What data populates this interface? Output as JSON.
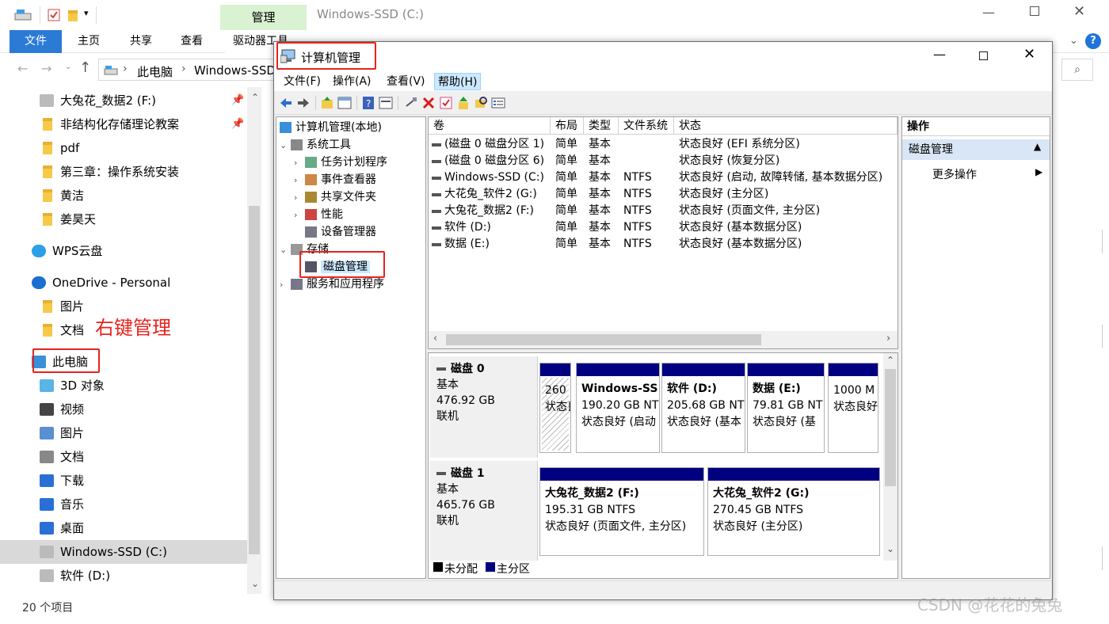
{
  "explorer": {
    "title": "Windows-SSD (C:)",
    "ribbon_context": "管理",
    "tabs": [
      "文件",
      "主页",
      "共享",
      "查看",
      "驱动器工具"
    ],
    "breadcrumb": [
      "此电脑",
      "Windows-SSD"
    ],
    "nav": [
      {
        "label": "大兔花_数据2 (F:)",
        "icon": "drive-icon",
        "pinned": true
      },
      {
        "label": "非结构化存储理论教案",
        "icon": "folder-icon",
        "pinned": true
      },
      {
        "label": "pdf",
        "icon": "folder-icon"
      },
      {
        "label": "第三章：操作系统安装",
        "icon": "folder-icon"
      },
      {
        "label": "黄洁",
        "icon": "folder-icon"
      },
      {
        "label": "姜昊天",
        "icon": "folder-icon"
      },
      {
        "label": "WPS云盘",
        "icon": "cloud-icon"
      },
      {
        "label": "OneDrive - Personal",
        "icon": "onedrive-icon"
      },
      {
        "label": "图片",
        "icon": "folder-icon"
      },
      {
        "label": "文档",
        "icon": "folder-icon"
      },
      {
        "label": "此电脑",
        "icon": "computer-icon"
      },
      {
        "label": "3D 对象",
        "icon": "cube-icon"
      },
      {
        "label": "视频",
        "icon": "video-icon"
      },
      {
        "label": "图片",
        "icon": "pictures-icon"
      },
      {
        "label": "文档",
        "icon": "documents-icon"
      },
      {
        "label": "下载",
        "icon": "download-icon"
      },
      {
        "label": "音乐",
        "icon": "music-icon"
      },
      {
        "label": "桌面",
        "icon": "desktop-icon"
      },
      {
        "label": "Windows-SSD (C:)",
        "icon": "drive-icon",
        "selected": true
      },
      {
        "label": "软件 (D:)",
        "icon": "drive-icon"
      }
    ],
    "status_count": "20 个项目",
    "annotation": "右键管理"
  },
  "cm": {
    "title": "计算机管理",
    "menu": [
      "文件(F)",
      "操作(A)",
      "查看(V)",
      "帮助(H)"
    ],
    "tree": [
      {
        "label": "计算机管理(本地)",
        "level": 0
      },
      {
        "label": "系统工具",
        "level": 1,
        "expander": "v"
      },
      {
        "label": "任务计划程序",
        "level": 2,
        "expander": ">"
      },
      {
        "label": "事件查看器",
        "level": 2,
        "expander": ">"
      },
      {
        "label": "共享文件夹",
        "level": 2,
        "expander": ">"
      },
      {
        "label": "性能",
        "level": 2,
        "expander": ">"
      },
      {
        "label": "设备管理器",
        "level": 2,
        "expander": ""
      },
      {
        "label": "存储",
        "level": 1,
        "expander": "v"
      },
      {
        "label": "磁盘管理",
        "level": 2,
        "expander": "",
        "selected": true
      },
      {
        "label": "服务和应用程序",
        "level": 1,
        "expander": ">"
      }
    ],
    "columns": [
      "卷",
      "布局",
      "类型",
      "文件系统",
      "状态"
    ],
    "volumes": [
      [
        "(磁盘 0 磁盘分区 1)",
        "简单",
        "基本",
        "",
        "状态良好 (EFI 系统分区)"
      ],
      [
        "(磁盘 0 磁盘分区 6)",
        "简单",
        "基本",
        "",
        "状态良好 (恢复分区)"
      ],
      [
        "Windows-SSD (C:)",
        "简单",
        "基本",
        "NTFS",
        "状态良好 (启动, 故障转储, 基本数据分区)"
      ],
      [
        "大花兔_软件2 (G:)",
        "简单",
        "基本",
        "NTFS",
        "状态良好 (主分区)"
      ],
      [
        "大兔花_数据2 (F:)",
        "简单",
        "基本",
        "NTFS",
        "状态良好 (页面文件, 主分区)"
      ],
      [
        "软件 (D:)",
        "简单",
        "基本",
        "NTFS",
        "状态良好 (基本数据分区)"
      ],
      [
        "数据 (E:)",
        "简单",
        "基本",
        "NTFS",
        "状态良好 (基本数据分区)"
      ]
    ],
    "disks": [
      {
        "name": "磁盘 0",
        "type": "基本",
        "size": "476.92 GB",
        "state": "联机",
        "parts": [
          {
            "name": "",
            "size": "260 M",
            "status": "状态良",
            "hatched": true
          },
          {
            "name": "Windows-SS",
            "size": "190.20 GB NT",
            "status": "状态良好 (启动"
          },
          {
            "name": "软件 (D:)",
            "size": "205.68 GB NT",
            "status": "状态良好 (基本"
          },
          {
            "name": "数据 (E:)",
            "size": "79.81 GB NT",
            "status": "状态良好 (基"
          },
          {
            "name": "",
            "size": "1000 M",
            "status": "状态良好"
          }
        ]
      },
      {
        "name": "磁盘 1",
        "type": "基本",
        "size": "465.76 GB",
        "state": "联机",
        "parts": [
          {
            "name": "大兔花_数据2 (F:)",
            "size": "195.31 GB NTFS",
            "status": "状态良好 (页面文件, 主分区)"
          },
          {
            "name": "大花兔_软件2 (G:)",
            "size": "270.45 GB NTFS",
            "status": "状态良好 (主分区)"
          }
        ]
      }
    ],
    "legend": [
      "未分配",
      "主分区"
    ],
    "actions_header": "操作",
    "actions_section": "磁盘管理",
    "actions_more": "更多操作"
  },
  "watermark": "CSDN @花花的兔兔"
}
